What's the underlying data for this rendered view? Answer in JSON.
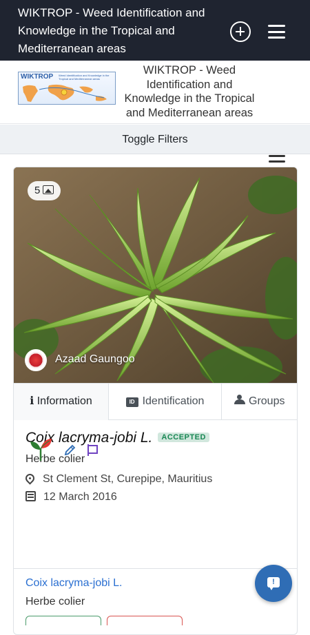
{
  "appbar": {
    "title": "WIKTROP - Weed Identification and Knowledge in the Tropical and Mediterranean areas",
    "add_icon": "plus-circle-icon",
    "menu_icon": "hamburger-icon"
  },
  "site_header": {
    "logo_text": "WIKTROP",
    "logo_subtitle": "Weed Identification and Knowledge in the Tropical and Mediterranean areas",
    "name": "WIKTROP - Weed Identification and Knowledge in the Tropical and Mediterranean areas",
    "menu_icon": "hamburger-icon"
  },
  "toggle_filters_label": "Toggle Filters",
  "observation": {
    "photo_count": "5",
    "author": "Azaad Gaungoo",
    "tabs": [
      {
        "label": "Information",
        "icon": "info-icon"
      },
      {
        "label": "Identification",
        "icon": "id-card-icon"
      },
      {
        "label": "Groups",
        "icon": "people-icon"
      }
    ],
    "scientific_name": "Coix lacryma-jobi L.",
    "status_badge": "ACCEPTED",
    "common_name": "Herbe colier",
    "location": "St Clement St, Curepipe, Mauritius",
    "date": "12 March 2016",
    "determination": {
      "scientific_name": "Coix lacryma-jobi L.",
      "common_name": "Herbe colier"
    }
  },
  "colors": {
    "appbar_bg": "#1f2430",
    "accent_blue": "#2f6db5",
    "accepted_green": "#198754",
    "link_blue": "#2a6fd1"
  }
}
